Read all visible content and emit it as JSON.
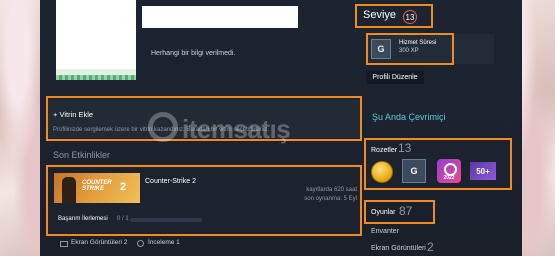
{
  "profile": {
    "no_info_text": "Herhangi bir bilgi verilmedi.",
    "level_label": "Seviye",
    "level_value": "13",
    "xp_title": "Hizmet Süresi",
    "xp_value": "300 XP",
    "xp_icon_letter": "G",
    "edit_button": "Profili Düzenle"
  },
  "showcase": {
    "title": "+ Vitrin Ekle",
    "subtitle": "Profilinizde sergilemek üzere bir vitrin kazandınız. Buradan bir vitrin seçebilirsiniz."
  },
  "watermark": {
    "text": "itemsatış"
  },
  "recent": {
    "title": "Son Etkinlikler",
    "game": {
      "name": "Counter-Strike 2",
      "hours": "kayıtlarda 620 saat",
      "last_played": "son oynanma: 5 Eyl",
      "image_line1": "COUNTER",
      "image_line2": "STRIKE",
      "image_num": "2",
      "achievement_label": "Başarım İlerlemesi",
      "achievement_count": "0 / 1",
      "achievement_progress": 0
    },
    "screenshots_label": "Ekran Görüntüleri 2",
    "reviews_label": "İnceleme 1"
  },
  "sidebar": {
    "online_status": "Şu Anda Çevrimiçi",
    "badges_label": "Rozetler",
    "badges_count": "13",
    "badge_g_letter": "G",
    "badge_year": "2022",
    "badge_50": "50+",
    "games_label": "Oyunlar",
    "games_count": "87",
    "inventory_label": "Envanter",
    "screenshots_label": "Ekran Görüntüleri",
    "screenshots_count": "2"
  },
  "colors": {
    "highlight": "#f08a24",
    "online": "#57cbde",
    "panel": "#1b222e"
  }
}
